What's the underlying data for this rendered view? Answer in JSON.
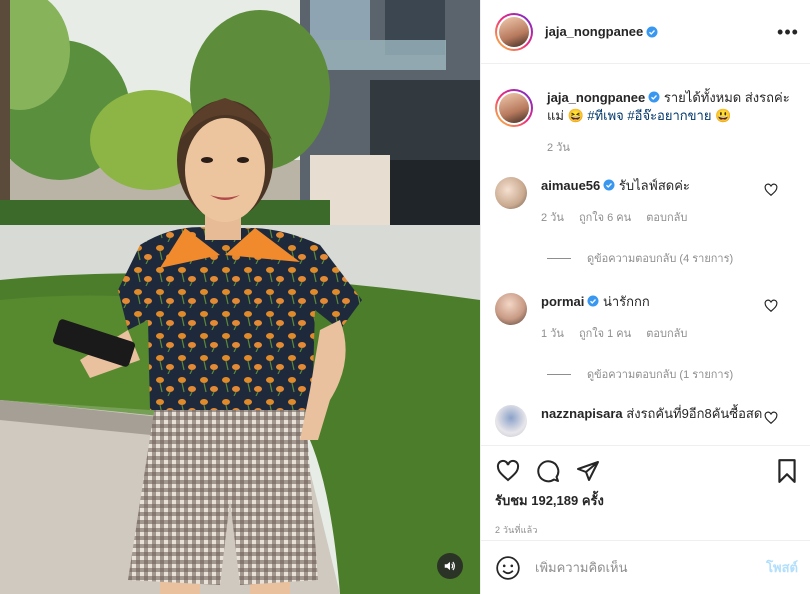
{
  "post": {
    "author": "jaja_nongpanee",
    "more_icon": "more-horizontal-icon",
    "caption_text": "รายได้ทั้งหมด ส่งรถค่ะแม่ 😆",
    "caption_tags": "#ทีเพจ #อีจ๊ะอยากขาย",
    "caption_end": "😃",
    "caption_time": "2 วัน"
  },
  "comments": [
    {
      "user": "aimaue56",
      "verified": true,
      "text": "รับไลฟ์สดค่ะ",
      "time": "2 วัน",
      "likes": "ถูกใจ 6 คน",
      "reply": "ตอบกลับ",
      "view_replies": "ดูข้อความตอบกลับ (4 รายการ)"
    },
    {
      "user": "pormai",
      "verified": true,
      "text": "น่ารักกก",
      "time": "1 วัน",
      "likes": "ถูกใจ 1 คน",
      "reply": "ตอบกลับ",
      "view_replies": "ดูข้อความตอบกลับ (1 รายการ)"
    },
    {
      "user": "nazznapisara",
      "verified": false,
      "text": "ส่งรถคันที่9อีก8คันซื้อสด"
    }
  ],
  "stats": {
    "views": "รับชม 192,189 ครั้ง",
    "posted": "2 วันที่แล้ว"
  },
  "composer": {
    "placeholder": "เพิ่มความคิดเห็น",
    "post_label": "โพสต์"
  },
  "colors": {
    "verified": "#3897f0",
    "link": "#00376b",
    "post_disabled": "#b2dffc"
  }
}
